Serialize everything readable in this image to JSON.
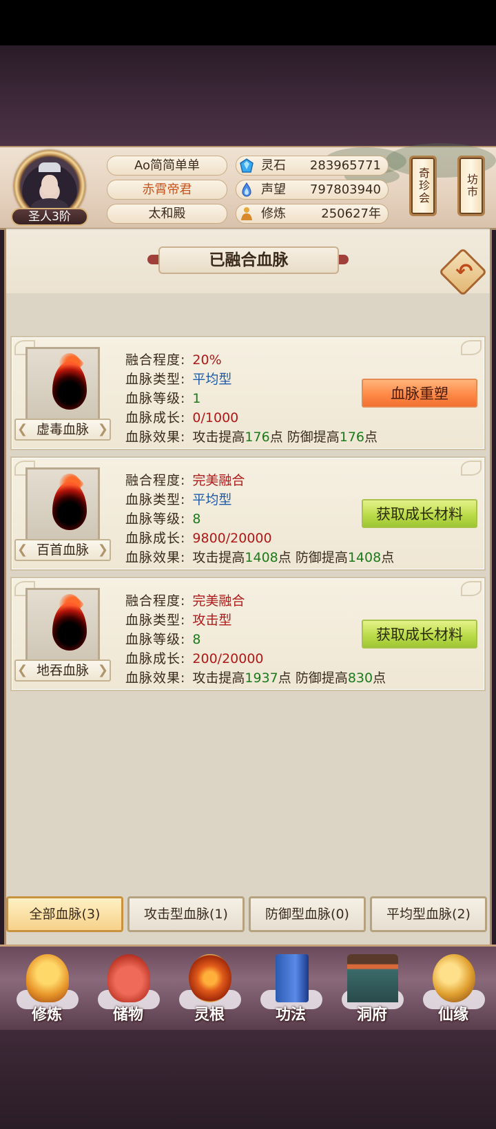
{
  "player": {
    "name": "Ao简简单单",
    "title": "赤霄帝君",
    "sect": "太和殿",
    "rank": "圣人3阶"
  },
  "resources": [
    {
      "icon": "spirit-stone-icon",
      "label": "灵石",
      "value": "283965771"
    },
    {
      "icon": "reputation-icon",
      "label": "声望",
      "value": "797803940"
    },
    {
      "icon": "cultivation-icon",
      "label": "修炼",
      "value": "250627年"
    }
  ],
  "side_buttons": {
    "treasure": "奇珍会",
    "market": "坊市"
  },
  "panel": {
    "title": "已融合血脉",
    "back_icon": "back-arrow-icon"
  },
  "stat_labels": {
    "fusion": "融合程度:",
    "type": "血脉类型:",
    "level": "血脉等级:",
    "growth": "血脉成长:",
    "effect": "血脉效果:"
  },
  "bloodlines": [
    {
      "name": "虚毒血脉",
      "fusion": "20%",
      "type": "平均型",
      "level": "1",
      "growth": "0/1000",
      "effect_attack_prefix": "攻击提高",
      "effect_attack": "176",
      "effect_defense_prefix": "点 防御提高",
      "effect_defense": "176",
      "effect_suffix": "点",
      "action": "血脉重塑"
    },
    {
      "name": "百首血脉",
      "fusion": "完美融合",
      "type": "平均型",
      "level": "8",
      "growth": "9800/20000",
      "effect_attack_prefix": "攻击提高",
      "effect_attack": "1408",
      "effect_defense_prefix": "点 防御提高",
      "effect_defense": "1408",
      "effect_suffix": "点",
      "action": "获取成长材料"
    },
    {
      "name": "地吞血脉",
      "fusion": "完美融合",
      "type": "攻击型",
      "level": "8",
      "growth": "200/20000",
      "effect_attack_prefix": "攻击提高",
      "effect_attack": "1937",
      "effect_defense_prefix": "点 防御提高",
      "effect_defense": "830",
      "effect_suffix": "点",
      "action": "获取成长材料"
    }
  ],
  "filter_tabs": [
    {
      "label": "全部血脉(3)",
      "active": true
    },
    {
      "label": "攻击型血脉(1)",
      "active": false
    },
    {
      "label": "防御型血脉(0)",
      "active": false
    },
    {
      "label": "平均型血脉(2)",
      "active": false
    }
  ],
  "bottom_nav": [
    {
      "label": "修炼",
      "icon": "meditating-monk-icon"
    },
    {
      "label": "储物",
      "icon": "storage-bag-icon"
    },
    {
      "label": "灵根",
      "icon": "spirit-root-icon"
    },
    {
      "label": "功法",
      "icon": "technique-book-icon"
    },
    {
      "label": "洞府",
      "icon": "cave-mansion-icon"
    },
    {
      "label": "仙缘",
      "icon": "immortal-fate-icon"
    }
  ],
  "colors": {
    "value_red": "#b01818",
    "value_blue": "#1c5aa8",
    "value_green": "#1a7a1a",
    "button_orange": "#ff8a48",
    "button_green": "#bcdc4a"
  }
}
